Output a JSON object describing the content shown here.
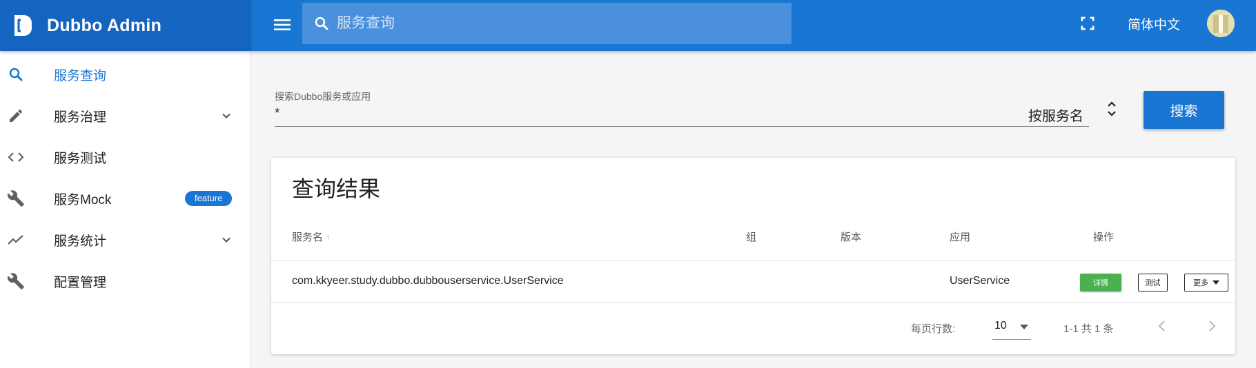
{
  "app": {
    "title": "Dubbo Admin"
  },
  "header": {
    "search_placeholder": "服务查询",
    "language": "简体中文"
  },
  "sidebar": {
    "items": [
      {
        "label": "服务查询",
        "icon": "search-icon",
        "active": true
      },
      {
        "label": "服务治理",
        "icon": "pencil-icon",
        "expandable": true
      },
      {
        "label": "服务测试",
        "icon": "code-icon"
      },
      {
        "label": "服务Mock",
        "icon": "wrench-icon",
        "badge": "feature"
      },
      {
        "label": "服务统计",
        "icon": "trending-icon",
        "expandable": true
      },
      {
        "label": "配置管理",
        "icon": "wrench-icon"
      }
    ]
  },
  "search": {
    "label": "搜索Dubbo服务或应用",
    "value": "*",
    "type": "按服务名",
    "button": "搜索"
  },
  "results": {
    "title": "查询结果",
    "columns": [
      "服务名",
      "组",
      "版本",
      "应用",
      "操作"
    ],
    "rows": [
      {
        "service": "com.kkyeer.study.dubbo.dubbouserservice.UserService",
        "group": "",
        "version": "",
        "app": "UserService",
        "actions": {
          "detail": "详情",
          "test": "测试",
          "more": "更多"
        }
      }
    ],
    "footer": {
      "rows_per_page_label": "每页行数:",
      "rows_per_page": "10",
      "range": "1-1 共 1 条"
    }
  },
  "colors": {
    "primary": "#1976d2",
    "brand": "#1565c0",
    "success": "#4caf50"
  }
}
